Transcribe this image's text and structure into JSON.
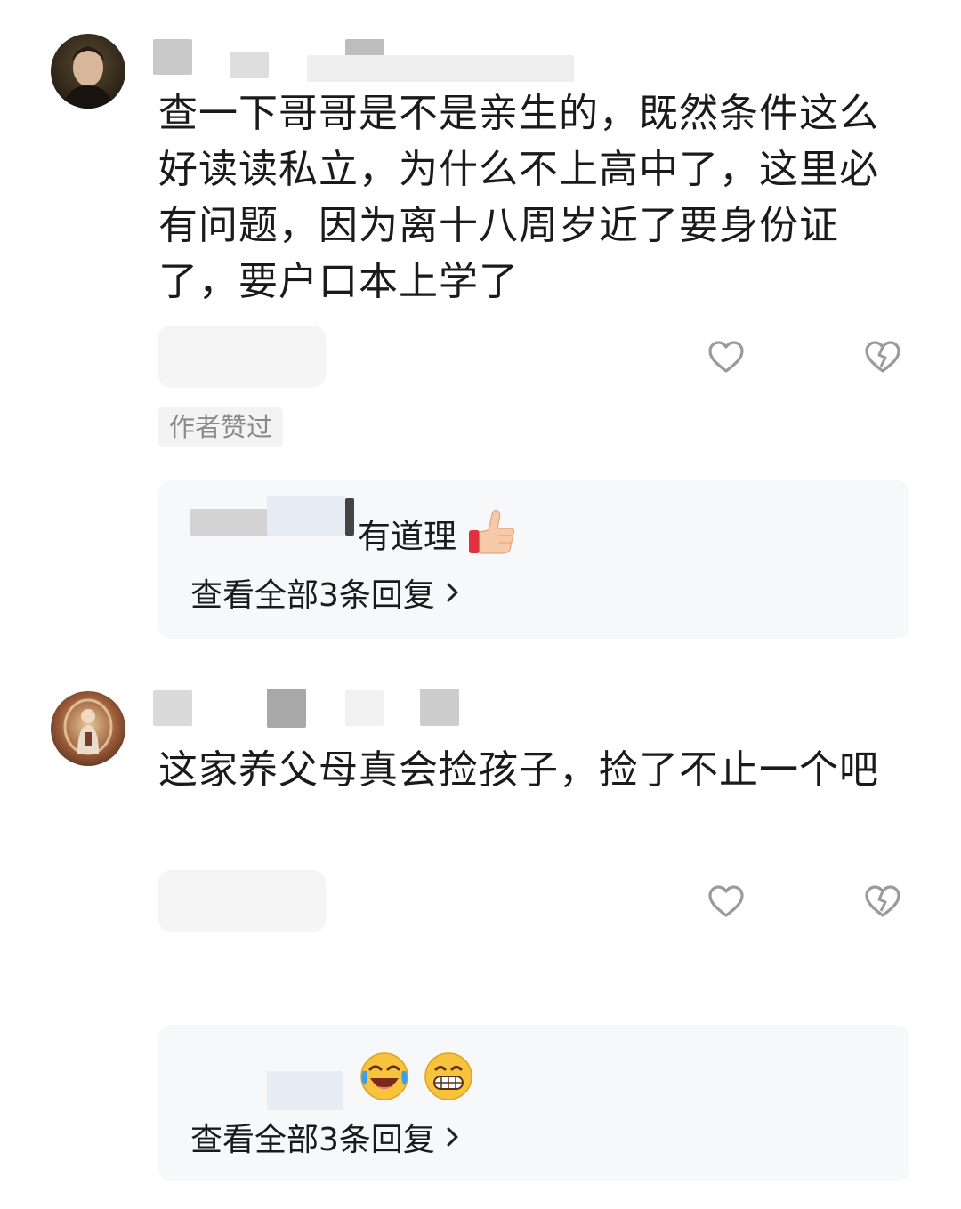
{
  "comments": [
    {
      "text": "查一下哥哥是不是亲生的，既然条件这么好读读私立，为什么不上高中了，这里必有问题，因为离十八周岁近了要身份证了，要户口本上学了",
      "author_tag": "作者赞过",
      "reply_preview": "有道理",
      "view_all": "查看全部3条回复"
    },
    {
      "text": "这家养父母真会捡孩子，捡了不止一个吧",
      "view_all": "查看全部3条回复"
    }
  ],
  "colors": {
    "text": "#1a1a1a",
    "muted": "#8a8a8a",
    "reply_bg": "#f7f8fa",
    "icon": "#9a9a9a"
  },
  "icons": {
    "like": "heart-outline-icon",
    "dislike": "broken-heart-icon",
    "more": "chevron-right-icon"
  }
}
